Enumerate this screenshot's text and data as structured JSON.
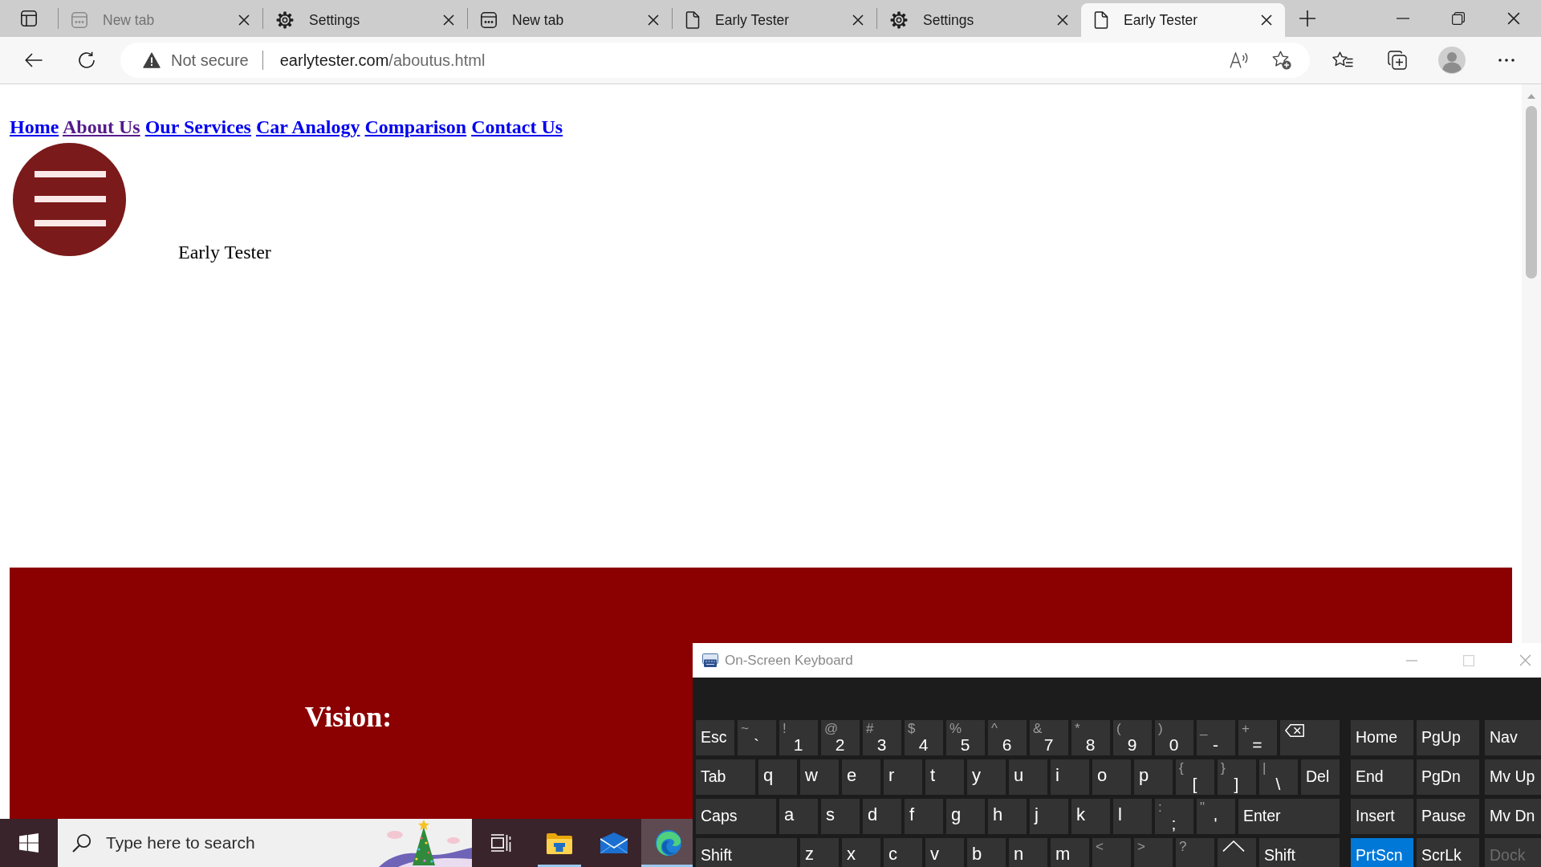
{
  "browser": {
    "tabs": [
      {
        "title": "New tab",
        "kind": "newtab",
        "selected": false,
        "faded": true
      },
      {
        "title": "Settings",
        "kind": "settings",
        "selected": false,
        "faded": false
      },
      {
        "title": "New tab",
        "kind": "newtab",
        "selected": false,
        "faded": false
      },
      {
        "title": "Early Tester",
        "kind": "page",
        "selected": false,
        "faded": false
      },
      {
        "title": "Settings",
        "kind": "settings",
        "selected": false,
        "faded": false
      },
      {
        "title": "Early Tester",
        "kind": "page",
        "selected": true,
        "faded": false
      }
    ],
    "address": {
      "security": "Not secure",
      "host": "earlytester.com",
      "path": "/aboutus.html"
    }
  },
  "page": {
    "nav_links": [
      {
        "label": "Home",
        "visited": false
      },
      {
        "label": "About Us",
        "visited": true
      },
      {
        "label": "Our Services",
        "visited": false
      },
      {
        "label": "Car Analogy",
        "visited": false
      },
      {
        "label": "Comparison",
        "visited": false
      },
      {
        "label": "Contact Us",
        "visited": false
      }
    ],
    "site_title": "Early Tester",
    "section_heading": "Vision:"
  },
  "taskbar": {
    "search": {
      "placeholder": "Type here to search"
    },
    "buttons": [
      {
        "kind": "taskview",
        "running": false,
        "active": false
      },
      {
        "kind": "folder",
        "running": true,
        "active": false
      },
      {
        "kind": "mail",
        "running": false,
        "active": false
      },
      {
        "kind": "browser",
        "running": true,
        "active": true
      }
    ]
  },
  "on_screen_keyboard": {
    "title": "On-Screen Keyboard",
    "rows": [
      {
        "main": [
          {
            "kind": "named",
            "label": "Esc",
            "on": false,
            "disabled": false
          },
          {
            "kind": "char",
            "shift": "~",
            "label": "`",
            "on": false,
            "disabled": false
          },
          {
            "kind": "char",
            "shift": "!",
            "label": "1",
            "on": false,
            "disabled": false
          },
          {
            "kind": "char",
            "shift": "@",
            "label": "2",
            "on": false,
            "disabled": false
          },
          {
            "kind": "char",
            "shift": "#",
            "label": "3",
            "on": false,
            "disabled": false
          },
          {
            "kind": "char",
            "shift": "$",
            "label": "4",
            "on": false,
            "disabled": false
          },
          {
            "kind": "char",
            "shift": "%",
            "label": "5",
            "on": false,
            "disabled": false
          },
          {
            "kind": "char",
            "shift": "^",
            "label": "6",
            "on": false,
            "disabled": false
          },
          {
            "kind": "char",
            "shift": "&",
            "label": "7",
            "on": false,
            "disabled": false
          },
          {
            "kind": "char",
            "shift": "*",
            "label": "8",
            "on": false,
            "disabled": false
          },
          {
            "kind": "char",
            "shift": "(",
            "label": "9",
            "on": false,
            "disabled": false
          },
          {
            "kind": "char",
            "shift": ")",
            "label": "0",
            "on": false,
            "disabled": false
          },
          {
            "kind": "char",
            "shift": "_",
            "label": "-",
            "on": false,
            "disabled": false
          },
          {
            "kind": "char",
            "shift": "+",
            "label": "=",
            "on": false,
            "disabled": false
          },
          {
            "kind": "backspace",
            "on": false,
            "disabled": false
          }
        ],
        "side": [
          {
            "kind": "named",
            "label": "Home",
            "on": false,
            "disabled": false
          },
          {
            "kind": "named",
            "label": "PgUp",
            "on": false,
            "disabled": false
          },
          {
            "kind": "named",
            "label": "Nav",
            "on": false,
            "disabled": false
          }
        ]
      },
      {
        "main": [
          {
            "kind": "named",
            "label": "Tab",
            "on": false,
            "disabled": false
          },
          {
            "kind": "letter",
            "label": "q",
            "on": false,
            "disabled": false
          },
          {
            "kind": "letter",
            "label": "w",
            "on": false,
            "disabled": false
          },
          {
            "kind": "letter",
            "label": "e",
            "on": false,
            "disabled": false
          },
          {
            "kind": "letter",
            "label": "r",
            "on": false,
            "disabled": false
          },
          {
            "kind": "letter",
            "label": "t",
            "on": false,
            "disabled": false
          },
          {
            "kind": "letter",
            "label": "y",
            "on": false,
            "disabled": false
          },
          {
            "kind": "letter",
            "label": "u",
            "on": false,
            "disabled": false
          },
          {
            "kind": "letter",
            "label": "i",
            "on": false,
            "disabled": false
          },
          {
            "kind": "letter",
            "label": "o",
            "on": false,
            "disabled": false
          },
          {
            "kind": "letter",
            "label": "p",
            "on": false,
            "disabled": false
          },
          {
            "kind": "char",
            "shift": "{",
            "label": "[",
            "on": false,
            "disabled": false
          },
          {
            "kind": "char",
            "shift": "}",
            "label": "]",
            "on": false,
            "disabled": false
          },
          {
            "kind": "char",
            "shift": "|",
            "label": "\\",
            "on": false,
            "disabled": false
          },
          {
            "kind": "named",
            "label": "Del",
            "on": false,
            "disabled": false
          }
        ],
        "side": [
          {
            "kind": "named",
            "label": "End",
            "on": false,
            "disabled": false
          },
          {
            "kind": "named",
            "label": "PgDn",
            "on": false,
            "disabled": false
          },
          {
            "kind": "named",
            "label": "Mv Up",
            "on": false,
            "disabled": false
          }
        ]
      },
      {
        "main": [
          {
            "kind": "named",
            "label": "Caps",
            "on": false,
            "disabled": false
          },
          {
            "kind": "letter",
            "label": "a",
            "on": false,
            "disabled": false
          },
          {
            "kind": "letter",
            "label": "s",
            "on": false,
            "disabled": false
          },
          {
            "kind": "letter",
            "label": "d",
            "on": false,
            "disabled": false
          },
          {
            "kind": "letter",
            "label": "f",
            "on": false,
            "disabled": false
          },
          {
            "kind": "letter",
            "label": "g",
            "on": false,
            "disabled": false
          },
          {
            "kind": "letter",
            "label": "h",
            "on": false,
            "disabled": false
          },
          {
            "kind": "letter",
            "label": "j",
            "on": false,
            "disabled": false
          },
          {
            "kind": "letter",
            "label": "k",
            "on": false,
            "disabled": false
          },
          {
            "kind": "letter",
            "label": "l",
            "on": false,
            "disabled": false
          },
          {
            "kind": "char",
            "shift": ":",
            "label": ";",
            "on": false,
            "disabled": false
          },
          {
            "kind": "char",
            "shift": "\"",
            "label": "'",
            "on": false,
            "disabled": false
          },
          {
            "kind": "named",
            "label": "Enter",
            "on": false,
            "disabled": false
          }
        ],
        "side": [
          {
            "kind": "named",
            "label": "Insert",
            "on": false,
            "disabled": false
          },
          {
            "kind": "named",
            "label": "Pause",
            "on": false,
            "disabled": false
          },
          {
            "kind": "named",
            "label": "Mv Dn",
            "on": false,
            "disabled": false
          }
        ]
      },
      {
        "main": [
          {
            "kind": "named",
            "label": "Shift",
            "on": false,
            "disabled": false
          },
          {
            "kind": "letter",
            "label": "z",
            "on": false,
            "disabled": false
          },
          {
            "kind": "letter",
            "label": "x",
            "on": false,
            "disabled": false
          },
          {
            "kind": "letter",
            "label": "c",
            "on": false,
            "disabled": false
          },
          {
            "kind": "letter",
            "label": "v",
            "on": false,
            "disabled": false
          },
          {
            "kind": "letter",
            "label": "b",
            "on": false,
            "disabled": false
          },
          {
            "kind": "letter",
            "label": "n",
            "on": false,
            "disabled": false
          },
          {
            "kind": "letter",
            "label": "m",
            "on": false,
            "disabled": false
          },
          {
            "kind": "char",
            "shift": "<",
            "on": false,
            "disabled": false
          },
          {
            "kind": "char",
            "shift": ">",
            "on": false,
            "disabled": false
          },
          {
            "kind": "char",
            "shift": "?",
            "on": false,
            "disabled": false
          },
          {
            "kind": "arrow",
            "on": false,
            "disabled": false
          },
          {
            "kind": "named",
            "label": "Shift",
            "on": false,
            "disabled": false
          }
        ],
        "side": [
          {
            "kind": "named",
            "label": "PrtScn",
            "on": true,
            "disabled": false
          },
          {
            "kind": "named",
            "label": "ScrLk",
            "on": false,
            "disabled": false
          },
          {
            "kind": "named",
            "label": "Dock",
            "on": false,
            "disabled": true
          }
        ]
      }
    ]
  }
}
